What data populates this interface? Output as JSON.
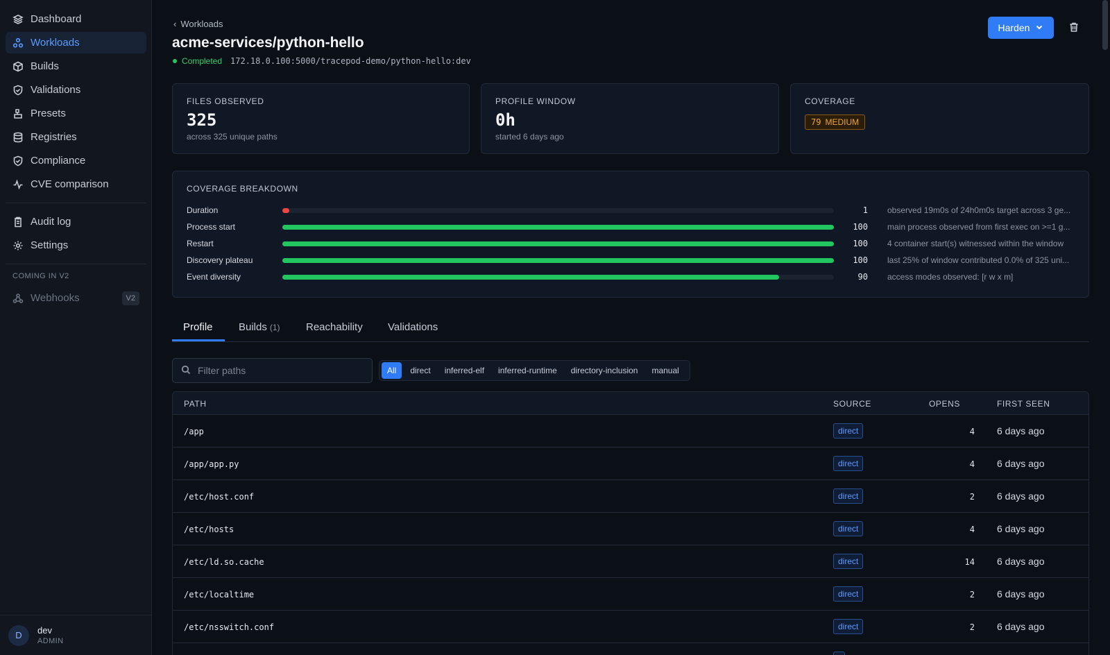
{
  "sidebar": {
    "items": [
      {
        "label": "Dashboard",
        "icon": "layers-icon"
      },
      {
        "label": "Workloads",
        "icon": "workloads-icon",
        "active": true
      },
      {
        "label": "Builds",
        "icon": "box-icon"
      },
      {
        "label": "Validations",
        "icon": "shield-check-icon"
      },
      {
        "label": "Presets",
        "icon": "presets-icon"
      },
      {
        "label": "Registries",
        "icon": "database-icon"
      },
      {
        "label": "Compliance",
        "icon": "shield-check-icon"
      },
      {
        "label": "CVE comparison",
        "icon": "activity-icon"
      }
    ],
    "items2": [
      {
        "label": "Audit log",
        "icon": "clipboard-icon"
      },
      {
        "label": "Settings",
        "icon": "gear-icon"
      }
    ],
    "section_label": "COMING IN V2",
    "upcoming": [
      {
        "label": "Webhooks",
        "badge": "V2",
        "icon": "webhook-icon"
      }
    ],
    "user": {
      "initial": "D",
      "name": "dev",
      "role": "ADMIN"
    }
  },
  "header": {
    "breadcrumb": "Workloads",
    "title": "acme-services/python-hello",
    "status": "Completed",
    "image_ref": "172.18.0.100:5000/tracepod-demo/python-hello:dev",
    "harden_label": "Harden"
  },
  "stats": {
    "files": {
      "label": "FILES OBSERVED",
      "value": "325",
      "sub": "across 325 unique paths"
    },
    "window": {
      "label": "PROFILE WINDOW",
      "value": "0h",
      "sub": "started 6 days ago"
    },
    "coverage": {
      "label": "COVERAGE",
      "score": "79",
      "level": "MEDIUM"
    }
  },
  "breakdown": {
    "title": "COVERAGE BREAKDOWN",
    "rows": [
      {
        "label": "Duration",
        "score": "1",
        "value": 1,
        "color": "#ef4444",
        "note": "observed 19m0s of 24h0m0s target across 3 ge..."
      },
      {
        "label": "Process start",
        "score": "100",
        "value": 100,
        "color": "#22c55e",
        "note": "main process observed from first exec on >=1 g..."
      },
      {
        "label": "Restart",
        "score": "100",
        "value": 100,
        "color": "#22c55e",
        "note": "4 container start(s) witnessed within the window"
      },
      {
        "label": "Discovery plateau",
        "score": "100",
        "value": 100,
        "color": "#22c55e",
        "note": "last 25% of window contributed 0.0% of 325 uni..."
      },
      {
        "label": "Event diversity",
        "score": "90",
        "value": 90,
        "color": "#22c55e",
        "note": "access modes observed: [r w x m]"
      }
    ]
  },
  "tabs": [
    {
      "label": "Profile",
      "active": true
    },
    {
      "label": "Builds",
      "count": "(1)"
    },
    {
      "label": "Reachability"
    },
    {
      "label": "Validations"
    }
  ],
  "filter": {
    "placeholder": "Filter paths",
    "chips": [
      "All",
      "direct",
      "inferred-elf",
      "inferred-runtime",
      "directory-inclusion",
      "manual"
    ]
  },
  "table": {
    "columns": {
      "path": "PATH",
      "source": "SOURCE",
      "opens": "OPENS",
      "first_seen": "FIRST SEEN"
    },
    "rows": [
      {
        "path": "/app",
        "source": "direct",
        "opens": "4",
        "first_seen": "6 days ago"
      },
      {
        "path": "/app/app.py",
        "source": "direct",
        "opens": "4",
        "first_seen": "6 days ago"
      },
      {
        "path": "/etc/host.conf",
        "source": "direct",
        "opens": "2",
        "first_seen": "6 days ago"
      },
      {
        "path": "/etc/hosts",
        "source": "direct",
        "opens": "4",
        "first_seen": "6 days ago"
      },
      {
        "path": "/etc/ld.so.cache",
        "source": "direct",
        "opens": "14",
        "first_seen": "6 days ago"
      },
      {
        "path": "/etc/localtime",
        "source": "direct",
        "opens": "2",
        "first_seen": "6 days ago"
      },
      {
        "path": "/etc/nsswitch.conf",
        "source": "direct",
        "opens": "2",
        "first_seen": "6 days ago"
      }
    ]
  }
}
